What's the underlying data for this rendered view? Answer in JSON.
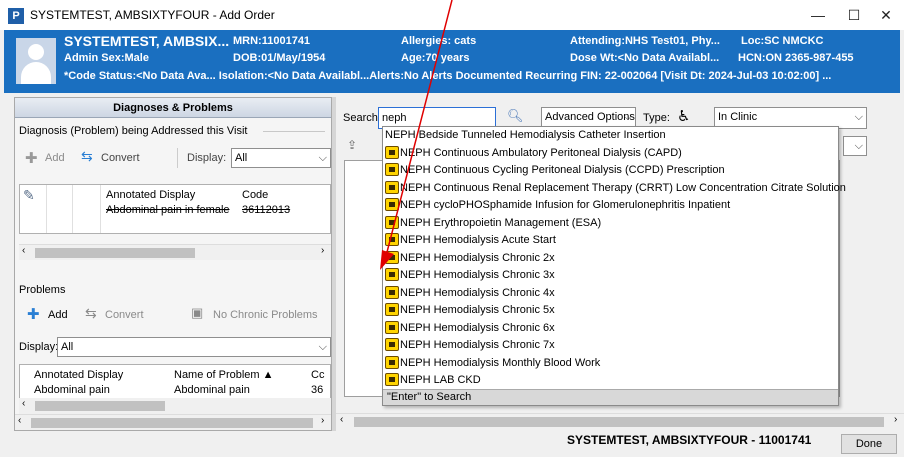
{
  "window": {
    "app_icon": "P",
    "title": "SYSTEMTEST, AMBSIXTYFOUR - Add Order",
    "minimize": "—",
    "maximize": "☐",
    "close": "✕"
  },
  "banner": {
    "name": "SYSTEMTEST, AMBSIX...",
    "sex": "Admin Sex:Male",
    "mrn": "MRN:11001741",
    "dob": "DOB:01/May/1954",
    "allergies": "Allergies: cats",
    "age": "Age:70 years",
    "attending": "Attending:NHS Test01, Phy...",
    "loc": "Loc:SC NMCKC",
    "dose_wt": "Dose Wt:<No Data Availabl...",
    "hcn": "HCN:ON 2365-987-455",
    "line3": "*Code Status:<No Data Ava... Isolation:<No Data Availabl...Alerts:No Alerts Documented Recurring FIN: 22-002064 [Visit Dt: 2024-Jul-03 10:02:00] ..."
  },
  "diagnoses": {
    "header": "Diagnoses & Problems",
    "group_label": "Diagnosis (Problem) being Addressed this Visit",
    "add_label": "Add",
    "convert_label": "Convert",
    "display_label": "Display:",
    "display_value": "All",
    "columns": [
      "Annotated Display",
      "Code"
    ],
    "rows": [
      {
        "display": "Abdominal pain in female",
        "code": "36112013"
      }
    ]
  },
  "problems": {
    "group_label": "Problems",
    "add_label": "Add",
    "convert_label": "Convert",
    "no_chronic_label": "No Chronic Problems",
    "display_label": "Display:",
    "display_value": "All",
    "columns": [
      "Annotated Display",
      "Name of Problem ▲",
      "Cc"
    ],
    "rows": [
      {
        "display": "Abdominal pain",
        "name": "Abdominal pain",
        "code": "36"
      }
    ]
  },
  "search": {
    "label": "Search:",
    "value": "neph",
    "advanced_options": "Advanced Options",
    "type_label": "Type:",
    "type_value": "In Clinic"
  },
  "dropdown": {
    "items": [
      {
        "label": "NEPH Bedside Tunneled Hemodialysis Catheter Insertion",
        "icon": false
      },
      {
        "label": "NEPH Continuous Ambulatory Peritoneal Dialysis (CAPD)",
        "icon": true
      },
      {
        "label": "NEPH Continuous Cycling Peritoneal Dialysis (CCPD) Prescription",
        "icon": true
      },
      {
        "label": "NEPH Continuous Renal Replacement Therapy (CRRT) Low Concentration Citrate Solution",
        "icon": true
      },
      {
        "label": "NEPH cycloPHOSphamide Infusion for Glomerulonephritis Inpatient",
        "icon": true
      },
      {
        "label": "NEPH Erythropoietin Management (ESA)",
        "icon": true
      },
      {
        "label": "NEPH Hemodialysis Acute Start",
        "icon": true
      },
      {
        "label": "NEPH Hemodialysis Chronic 2x",
        "icon": true
      },
      {
        "label": "NEPH Hemodialysis Chronic 3x",
        "icon": true
      },
      {
        "label": "NEPH Hemodialysis Chronic 4x",
        "icon": true
      },
      {
        "label": "NEPH Hemodialysis Chronic 5x",
        "icon": true
      },
      {
        "label": "NEPH Hemodialysis Chronic 6x",
        "icon": true
      },
      {
        "label": "NEPH Hemodialysis Chronic 7x",
        "icon": true
      },
      {
        "label": "NEPH Hemodialysis Monthly Blood Work",
        "icon": true
      },
      {
        "label": "NEPH LAB CKD",
        "icon": true
      }
    ],
    "footer": "\"Enter\" to Search"
  },
  "statusbar": {
    "patient": "SYSTEMTEST, AMBSIXTYFOUR - 11001741",
    "done": "Done"
  },
  "colors": {
    "banner": "#1a6fc0",
    "annotation_arrow": "#e00000"
  }
}
